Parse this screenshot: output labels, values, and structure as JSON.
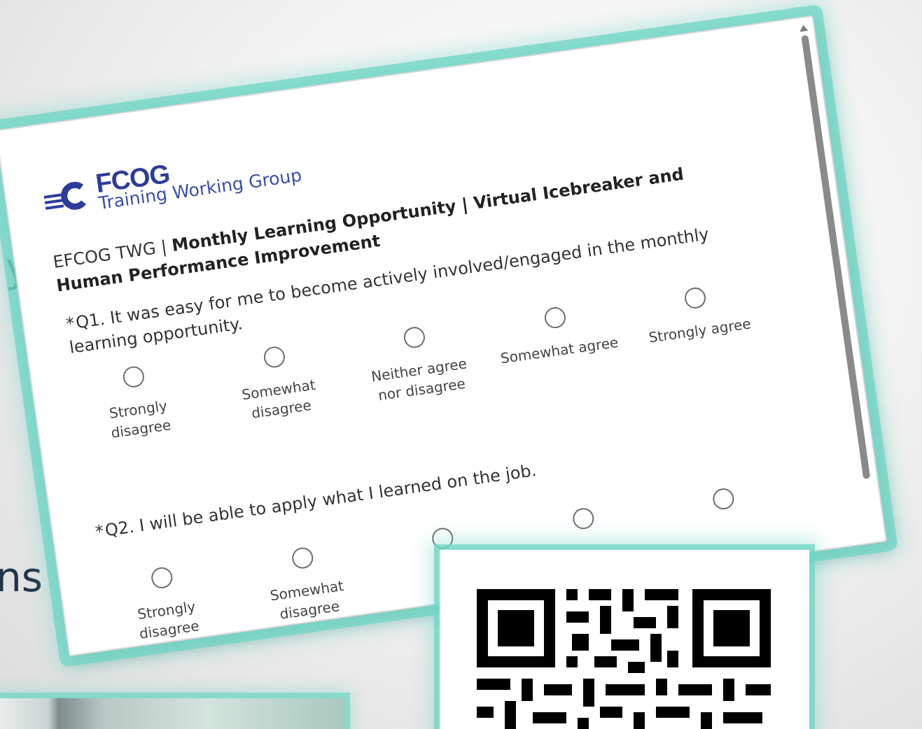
{
  "slide": {
    "fragment_top": "y",
    "fragment_bottom": "ns"
  },
  "logo": {
    "brand": "FCOG",
    "subtitle": "Training Working Group"
  },
  "survey": {
    "title_prefix": "EFCOG TWG | ",
    "title_bold": "Monthly Learning Opportunity | Virtual Icebreaker and Human Performance Improvement",
    "questions": [
      {
        "required_marker": "*",
        "text": "Q1. It was easy for me to become actively involved/engaged in the monthly learning opportunity.",
        "options": [
          {
            "label": "Strongly disagree"
          },
          {
            "label": "Somewhat disagree"
          },
          {
            "label": "Neither agree nor disagree"
          },
          {
            "label": "Somewhat agree"
          },
          {
            "label": "Strongly agree"
          }
        ]
      },
      {
        "required_marker": "*",
        "text": "Q2. I will be able to apply what I learned on the job.",
        "options": [
          {
            "label": "Strongly disagree"
          },
          {
            "label": "Somewhat disagree"
          },
          {
            "label": ""
          },
          {
            "label": ""
          },
          {
            "label": ""
          }
        ]
      }
    ]
  },
  "icons": {
    "scroll_up": "scroll-up-arrow-icon",
    "qr": "qr-code-icon",
    "logo": "efcog-logo-icon"
  },
  "colors": {
    "accent_glow": "#6ed6c4",
    "brand_blue": "#2d3d9b",
    "slide_text": "#1f3447"
  }
}
